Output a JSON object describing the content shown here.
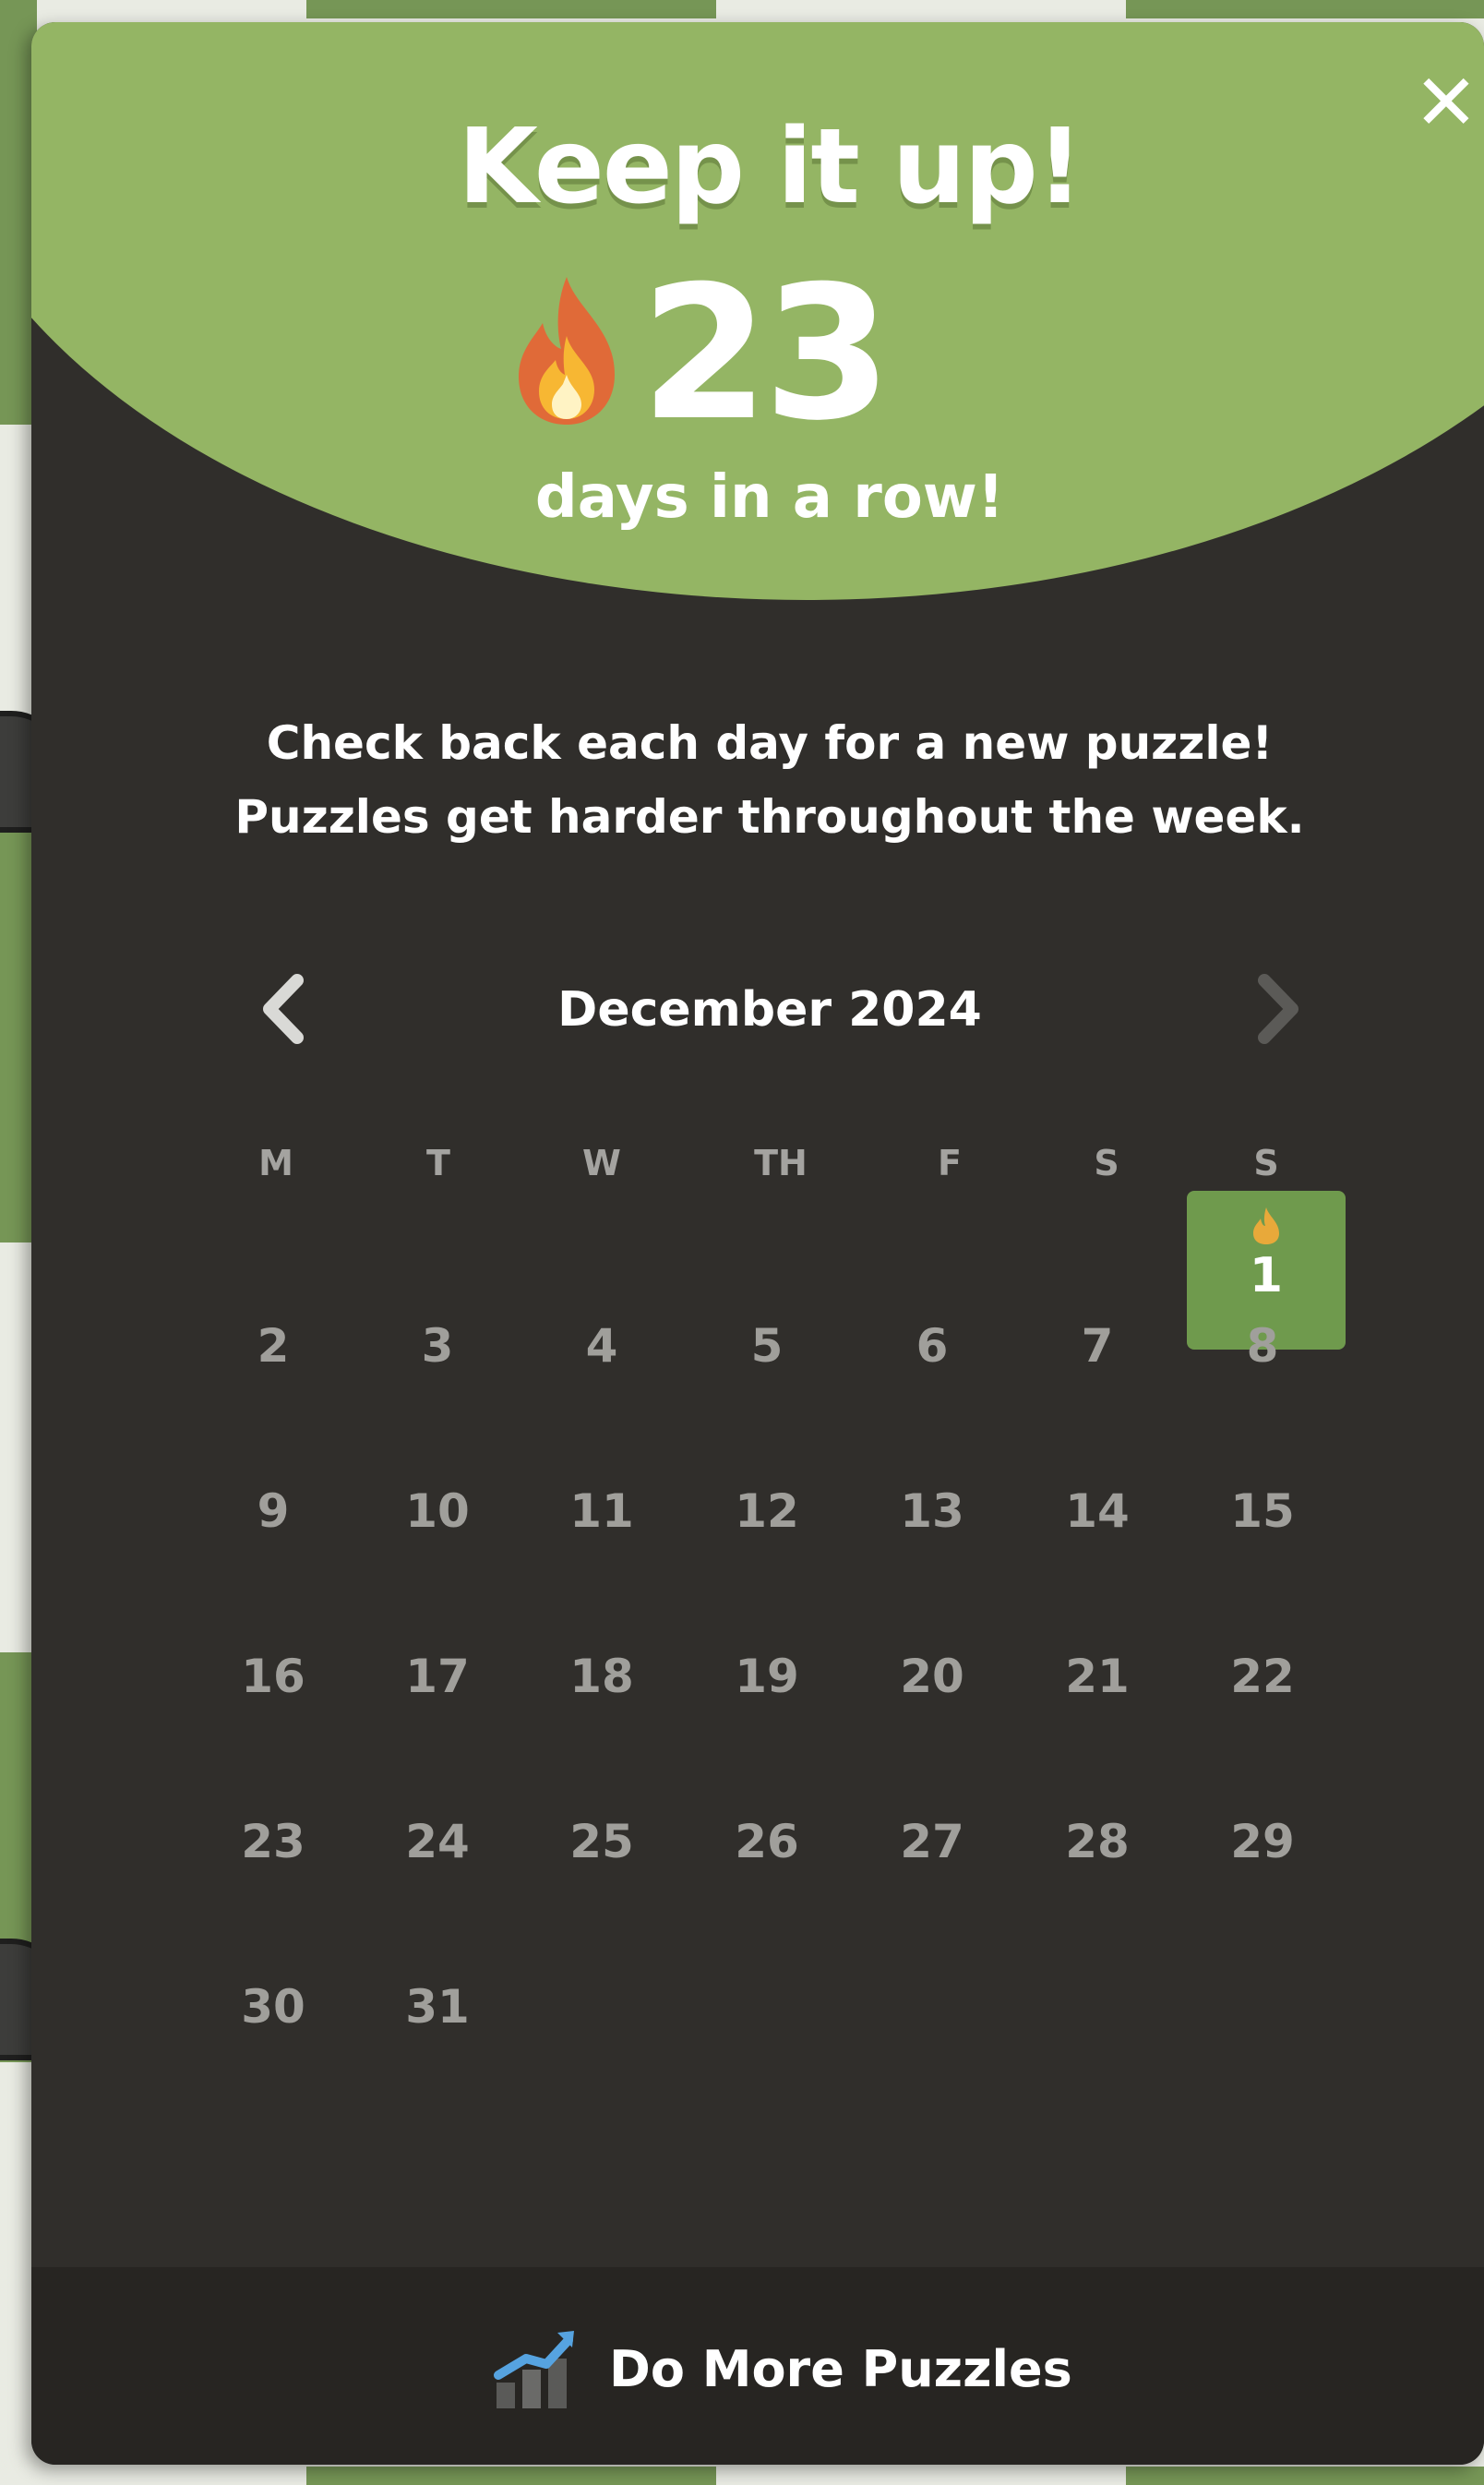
{
  "colors": {
    "hero_green": "#94b564",
    "modal_bg": "#302e2b",
    "footer_bg": "#272522",
    "active_day": "#6f9a4d",
    "muted_text": "#a09f9b",
    "board_light": "#e9ebe3",
    "board_dark": "#769656"
  },
  "modal": {
    "close_icon": "close-icon",
    "title": "Keep it up!",
    "streak_icon": "flame-icon",
    "streak_count": "23",
    "streak_label": "days in a row!",
    "message_line1": "Check back each day for a new puzzle!",
    "message_line2": "Puzzles get harder throughout the week."
  },
  "calendar": {
    "month_label": "December 2024",
    "prev_icon": "chevron-left-icon",
    "next_icon": "chevron-right-icon",
    "weekdays": [
      "M",
      "T",
      "W",
      "TH",
      "F",
      "S",
      "S"
    ],
    "active_day": "1",
    "active_day_icon": "flame-icon",
    "days": [
      "2",
      "3",
      "4",
      "5",
      "6",
      "7",
      "8",
      "9",
      "10",
      "11",
      "12",
      "13",
      "14",
      "15",
      "16",
      "17",
      "18",
      "19",
      "20",
      "21",
      "22",
      "23",
      "24",
      "25",
      "26",
      "27",
      "28",
      "29",
      "30",
      "31"
    ]
  },
  "footer": {
    "button_icon": "trending-chart-icon",
    "button_label": "Do More Puzzles"
  }
}
